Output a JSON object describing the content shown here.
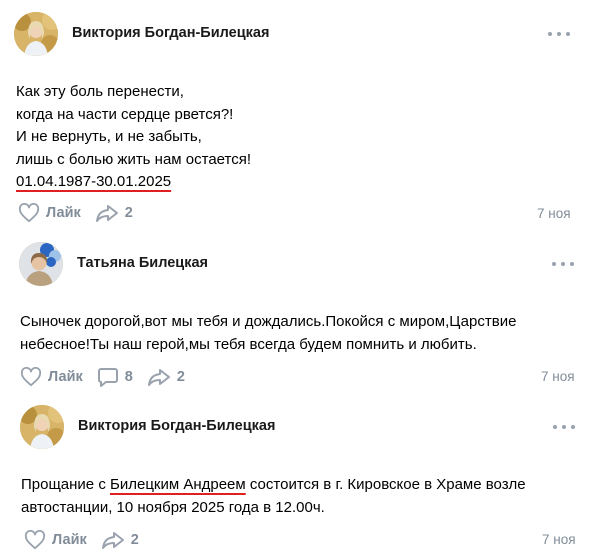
{
  "posts": [
    {
      "author": "Виктория Богдан-Билецкая",
      "lines": [
        "Как эту боль перенести,",
        "когда на части сердце рвется?!",
        "И не вернуть, и не забыть,",
        "лишь с болью жить нам остается!",
        "01.04.1987-30.01.2025"
      ],
      "like_label": "Лайк",
      "share_count": "2",
      "date": "7 ноя",
      "avatar_icon": "woman-portrait-autumn-icon"
    },
    {
      "author": "Татьяна Билецкая",
      "lines": [
        "Сыночек дорогой,вот мы тебя и дождались.Покойся с миром,Царствие",
        "небесное!Ты наш герой,мы тебя всегда будем помнить и любить."
      ],
      "like_label": "Лайк",
      "comment_count": "8",
      "share_count": "2",
      "date": "7 ноя",
      "avatar_icon": "woman-portrait-balloons-icon"
    },
    {
      "author": "Виктория Богдан-Билецкая",
      "line1_pre": "Прощание с ",
      "line1_hl": "Билецким Андреем",
      "line1_post": " состоится в г. Кировское в Храме возле",
      "line2": "автостанции, 10 ноября 2025 года в 12.00ч.",
      "like_label": "Лайк",
      "share_count": "2",
      "date": "7 ноя",
      "avatar_icon": "woman-portrait-autumn-icon"
    }
  ],
  "colors": {
    "muted": "#818c99",
    "underline": "#e02020",
    "dots": "#99a2ad"
  }
}
